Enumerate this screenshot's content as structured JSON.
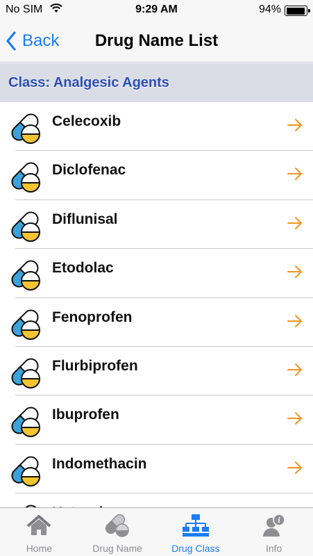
{
  "status_bar": {
    "carrier": "No SIM",
    "time": "9:29 AM",
    "battery": "94%"
  },
  "nav": {
    "back_label": "Back",
    "title": "Drug Name List"
  },
  "section": {
    "header": "Class: Analgesic Agents"
  },
  "drugs": [
    "Celecoxib",
    "Diclofenac",
    "Diflunisal",
    "Etodolac",
    "Fenoprofen",
    "Flurbiprofen",
    "Ibuprofen",
    "Indomethacin",
    "Ketorolac"
  ],
  "tabs": [
    {
      "label": "Home",
      "icon": "home-icon",
      "active": false
    },
    {
      "label": "Drug Name",
      "icon": "pill-icon",
      "active": false
    },
    {
      "label": "Drug Class",
      "icon": "hierarchy-icon",
      "active": true
    },
    {
      "label": "Info",
      "icon": "info-person-icon",
      "active": false
    }
  ],
  "colors": {
    "accent": "#1b7cf3",
    "arrow": "#f0961e",
    "pill_blue": "#3ba3dc",
    "pill_yellow": "#f5c430",
    "section_bg": "#dadde6",
    "section_text": "#2c4fb3"
  }
}
